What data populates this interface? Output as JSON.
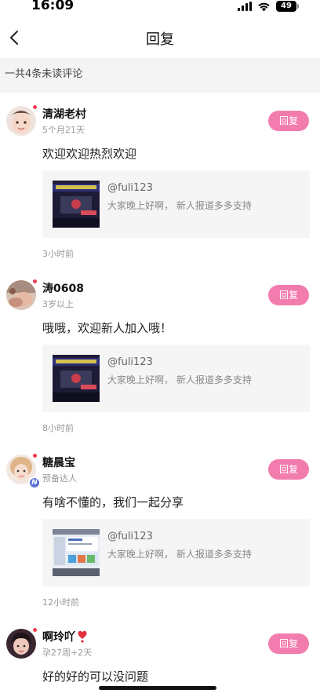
{
  "status": {
    "time": "16:09",
    "battery": "49"
  },
  "nav": {
    "title": "回复"
  },
  "unread_summary": "一共4条未读评论",
  "comments": [
    {
      "name": "清湖老村",
      "sub": "5个月21天",
      "reply_label": "回复",
      "text": "欢迎欢迎热烈欢迎",
      "quote_user": "@fuli123",
      "quote_text": "大家晚上好啊， 新人报道多多支持",
      "time": "3小时前"
    },
    {
      "name": "涛0608",
      "sub": "3岁以上",
      "reply_label": "回复",
      "text": "哦哦，欢迎新人加入哦！",
      "quote_user": "@fuli123",
      "quote_text": "大家晚上好啊， 新人报道多多支持",
      "time": "8小时前"
    },
    {
      "name": "糖晨宝",
      "sub": "预备达人",
      "reply_label": "回复",
      "text": "有啥不懂的，我们一起分享",
      "quote_user": "@fuli123",
      "quote_text": "大家晚上好啊， 新人报道多多支持",
      "time": "12小时前"
    },
    {
      "name": "啊玲吖",
      "sub": "孕27周+2天",
      "reply_label": "回复",
      "text": "好的好的可以没问题"
    }
  ],
  "badge_letter": "N",
  "colors": {
    "accent": "#f37cae",
    "unread_dot": "#f03a4f",
    "unread_bar_bg": "#f4f4f5"
  }
}
